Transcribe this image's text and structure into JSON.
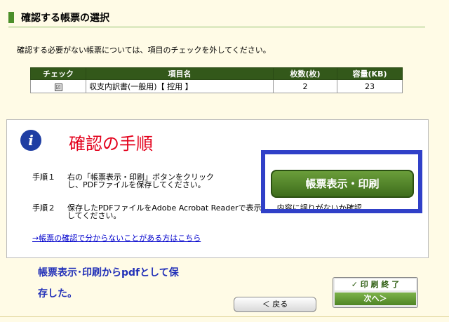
{
  "section": {
    "title": "確認する帳票の選択"
  },
  "intro": "確認する必要がない帳票については、項目のチェックを外してください。",
  "table": {
    "headers": [
      "チェック",
      "項目名",
      "枚数(枚)",
      "容量(KB)"
    ],
    "rows": [
      {
        "check": "☑",
        "name": "収支内訳書(一般用)【 控用 】",
        "count": "2",
        "size": "23"
      }
    ]
  },
  "panel": {
    "icon": "info-icon",
    "title": "確認の手順",
    "step1_label": "手順１",
    "step1_text": "右の「帳票表示・印刷」ボタンをクリック\nし、PDFファイルを保存してください。",
    "step2_label": "手順２",
    "step2_text": "保存したPDFファイルをAdobe Acrobat Readerで表示し、内容に誤りがないか確認\nしてください。",
    "help_link": "→帳票の確認で分からないことがある方はこちら"
  },
  "print_button": "帳票表示・印刷",
  "annotation": {
    "line1": "帳票表示･印刷からpdfとして保",
    "line2": "存した。"
  },
  "finish_button": {
    "top": "✓ 印 刷 終 了",
    "bottom": "次へ＞"
  },
  "back_button": "＜ 戻る",
  "colors": {
    "accent_green": "#33581a",
    "highlight_blue": "#3040c8",
    "title_red": "#e3001b"
  }
}
